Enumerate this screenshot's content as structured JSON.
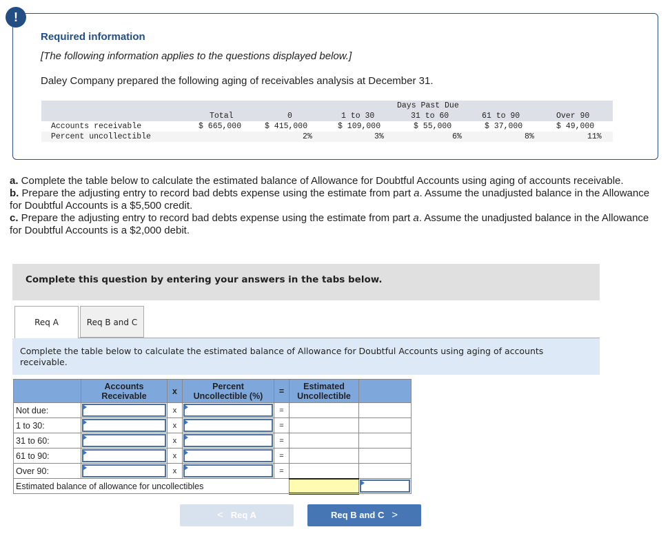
{
  "info": {
    "badge_icon": "exclamation-icon",
    "badge_glyph": "!",
    "title": "Required information",
    "subtitle": "[The following information applies to the questions displayed below.]",
    "description": "Daley Company prepared the following aging of receivables analysis at December 31."
  },
  "aging_table": {
    "group_header": "Days Past Due",
    "columns": [
      "Total",
      "0",
      "1 to 30",
      "31 to 60",
      "61 to 90",
      "Over 90"
    ],
    "rows": [
      {
        "label": "Accounts receivable",
        "values": [
          "$ 665,000",
          "$ 415,000",
          "$ 109,000",
          "$ 55,000",
          "$ 37,000",
          "$ 49,000"
        ]
      },
      {
        "label": "Percent uncollectible",
        "values": [
          "",
          "2%",
          "3%",
          "6%",
          "8%",
          "11%"
        ]
      }
    ]
  },
  "questions": {
    "a_label": "a.",
    "a_text": " Complete the table below to calculate the estimated balance of Allowance for Doubtful Accounts using aging of accounts receivable.",
    "b_label": "b.",
    "b_text_1": " Prepare the adjusting entry to record bad debts expense using the estimate from part ",
    "b_part": "a",
    "b_text_2": ". Assume the unadjusted balance in the Allowance for Doubtful Accounts is a $5,500 credit.",
    "c_label": "c.",
    "c_text_1": " Prepare the adjusting entry to record bad debts expense using the estimate from part ",
    "c_part": "a",
    "c_text_2": ". Assume the unadjusted balance in the Allowance for Doubtful Accounts is a $2,000 debit."
  },
  "banner": "Complete this question by entering your answers in the tabs below.",
  "tabs": [
    {
      "label": "Req A",
      "active": true
    },
    {
      "label": "Req B and C",
      "active": false
    }
  ],
  "panel_description": "Complete the table below to calculate the estimated balance of Allowance for Doubtful Accounts using aging of accounts receivable.",
  "work_table": {
    "headers": {
      "ar_line1": "Accounts",
      "ar_line2": "Receivable",
      "times": "x",
      "pct_line1": "Percent",
      "pct_line2": "Uncollectible (%)",
      "equals": "=",
      "est_line1": "Estimated",
      "est_line2": "Uncollectible"
    },
    "rows": [
      {
        "label": "Not due:",
        "ar": "",
        "pct": "",
        "op1": "x",
        "op2": "=",
        "est": ""
      },
      {
        "label": "1 to 30:",
        "ar": "",
        "pct": "",
        "op1": "x",
        "op2": "=",
        "est": ""
      },
      {
        "label": "31 to 60:",
        "ar": "",
        "pct": "",
        "op1": "x",
        "op2": "=",
        "est": ""
      },
      {
        "label": "61 to 90:",
        "ar": "",
        "pct": "",
        "op1": "x",
        "op2": "=",
        "est": ""
      },
      {
        "label": "Over 90:",
        "ar": "",
        "pct": "",
        "op1": "x",
        "op2": "=",
        "est": ""
      }
    ],
    "total_label": "Estimated balance of allowance for uncollectibles",
    "total_value": ""
  },
  "nav": {
    "prev_label": "Req A",
    "prev_icon": "chevron-left-icon",
    "prev_glyph": "<",
    "next_label": "Req B and C",
    "next_icon": "chevron-right-icon",
    "next_glyph": ">"
  }
}
